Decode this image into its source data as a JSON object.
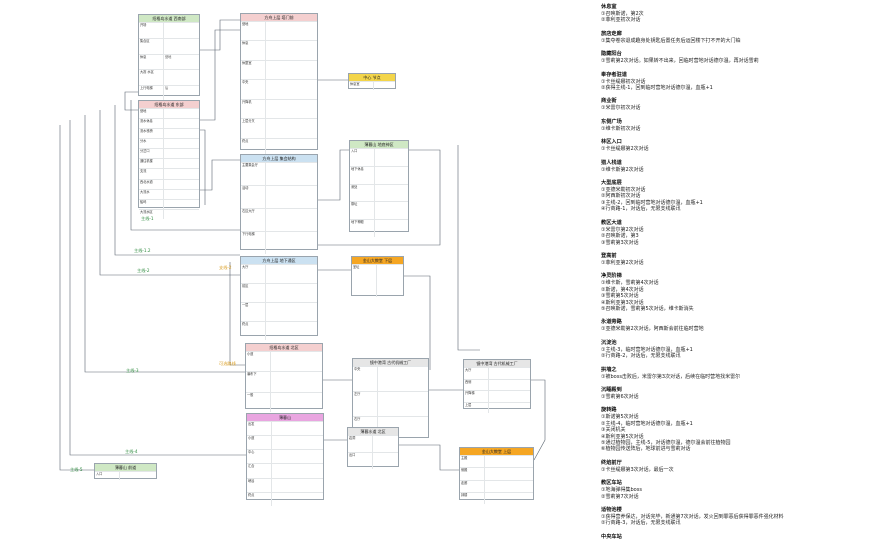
{
  "colors": {
    "line": "#5a6570",
    "green_header": "#cfe8c4",
    "pink_header": "#f4cfcf",
    "blue_header": "#cbe1f1",
    "gray_header": "#e6e6e6",
    "yellow_header": "#f3d54a",
    "orange_header": "#f5a623",
    "magenta_header": "#e9a5e0",
    "label_green": "#2d8a3e",
    "label_orange": "#d89a1a"
  },
  "diagram": {
    "nodes": [
      {
        "id": "n1",
        "title": "绍格岛水道 西南部",
        "header": "green",
        "rows": [
          [
            "开场",
            ""
          ],
          [
            "集合区",
            ""
          ],
          [
            "休息",
            "营地"
          ],
          [
            "大赛 水区",
            ""
          ],
          [
            "上行电梯",
            "后"
          ]
        ]
      },
      {
        "id": "n2",
        "title": "绍格岛水道 东部",
        "header": "pink",
        "rows": [
          [
            "营地",
            ""
          ],
          [
            "流水休息",
            ""
          ],
          [
            "流水栈桥",
            ""
          ],
          [
            "分水",
            ""
          ],
          [
            "分岔口",
            ""
          ],
          [
            "通往机楼",
            ""
          ],
          [
            "支流",
            ""
          ],
          [
            "西北水道",
            ""
          ],
          [
            "大流水",
            ""
          ],
          [
            "船坞",
            ""
          ],
          [
            "大流水区",
            ""
          ]
        ]
      },
      {
        "id": "n3",
        "title": "方舟上层 塔门前",
        "header": "pink",
        "rows": [
          [
            "营地",
            ""
          ],
          [
            "休息",
            ""
          ],
          [
            "休整室",
            ""
          ],
          [
            "中央",
            ""
          ],
          [
            "升降机",
            ""
          ],
          [
            "上层分叉",
            ""
          ],
          [
            "终点",
            ""
          ]
        ]
      },
      {
        "id": "n4",
        "title": "中心 节点",
        "header": "yellow",
        "rows": [
          [
            "休息室",
            ""
          ]
        ]
      },
      {
        "id": "n5",
        "title": "方舟上层 集会结构",
        "header": "blue",
        "rows": [
          [
            "主要集会厅",
            ""
          ],
          [
            "活动",
            ""
          ],
          [
            "右边大厅",
            ""
          ],
          [
            "下行电梯",
            ""
          ]
        ]
      },
      {
        "id": "n6",
        "title": "薄暮山 地底神区",
        "header": "green",
        "rows": [
          [
            "入口",
            ""
          ],
          [
            "地下休息",
            ""
          ],
          [
            "深处",
            ""
          ],
          [
            "祭坛",
            ""
          ],
          [
            "地下神殿",
            ""
          ]
        ]
      },
      {
        "id": "n7",
        "title": "方舟上层 地下通区",
        "header": "blue",
        "rows": [
          [
            "大厅",
            ""
          ],
          [
            "前区",
            ""
          ],
          [
            "一层",
            ""
          ],
          [
            "终点",
            ""
          ]
        ]
      },
      {
        "id": "n8",
        "title": "金山大教堂 下层",
        "header": "orange",
        "rows": [
          [
            "圣坛",
            ""
          ]
        ]
      },
      {
        "id": "n9",
        "title": "绍格岛水道 北区",
        "header": "pink",
        "rows": [
          [
            "小道",
            ""
          ],
          [
            "瀑布下",
            ""
          ],
          [
            "一般",
            ""
          ]
        ]
      },
      {
        "id": "n10",
        "title": "镜中港湾 古代机械工厂",
        "header": "gray",
        "rows": [
          [
            "中央",
            ""
          ],
          [
            "左厅",
            ""
          ],
          [
            "右厅",
            ""
          ]
        ]
      },
      {
        "id": "n11",
        "title": "镜中港湾 古代机械工厂",
        "header": "gray",
        "rows": [
          [
            "大厅",
            ""
          ],
          [
            "西侧",
            ""
          ],
          [
            "升降梯",
            ""
          ],
          [
            "上层",
            ""
          ]
        ]
      },
      {
        "id": "n12",
        "title": "薄暮山",
        "header": "magenta",
        "rows": [
          [
            "出发",
            ""
          ],
          [
            "小道",
            ""
          ],
          [
            "中心",
            ""
          ],
          [
            "汇合",
            ""
          ],
          [
            "峡谷",
            ""
          ],
          [
            "终点",
            ""
          ]
        ]
      },
      {
        "id": "n13",
        "title": "薄暮水道 北区",
        "header": "gray",
        "rows": [
          [
            "岩洞",
            ""
          ],
          [
            "出口",
            ""
          ]
        ]
      },
      {
        "id": "n14",
        "title": "金山大教堂 上层",
        "header": "orange",
        "rows": [
          [
            "主殿",
            ""
          ],
          [
            "侧殿",
            ""
          ],
          [
            "走廊",
            ""
          ],
          [
            "钟楼",
            ""
          ]
        ]
      },
      {
        "id": "n15",
        "title": "薄暮山 前道",
        "header": "green",
        "rows": [
          [
            "入口",
            ""
          ]
        ]
      }
    ],
    "edge_labels": [
      {
        "text": "主线-1",
        "color": "green"
      },
      {
        "text": "主线-1.2",
        "color": "green"
      },
      {
        "text": "主线-2",
        "color": "green"
      },
      {
        "text": "支线-2",
        "color": "orange"
      },
      {
        "text": "可选路线",
        "color": "orange"
      },
      {
        "text": "主线-3",
        "color": "green"
      },
      {
        "text": "主线-4",
        "color": "green"
      },
      {
        "text": "主线-5",
        "color": "green"
      }
    ]
  },
  "notes": [
    {
      "title": "休息室",
      "lines": [
        "①召唤斯诺，第2次",
        "②菲利亚初次对话"
      ]
    },
    {
      "title": "旅店走廊",
      "lines": [
        "①集夺卷宗退成趣身处钥匙后置任务后运回楼下打不开的大门铂"
      ]
    },
    {
      "title": "隐藏阳台",
      "lines": [
        "①雪莉第2次对话。如果转不出来，回临时营地对话德尔温，再对话雪莉"
      ]
    },
    {
      "title": "奉存者驻道",
      "lines": [
        "①卡丝缇娜初次对话",
        "②获得主线-1，回到临时营地对话德尔温，血瓶+1"
      ]
    },
    {
      "title": "商业街",
      "lines": [
        "①米雷尔初次对话"
      ]
    },
    {
      "title": "东侧广场",
      "lines": [
        "①维卡斯初次对话"
      ]
    },
    {
      "title": "林区入口",
      "lines": [
        "①卡丝缇娜第2次对话"
      ]
    },
    {
      "title": "猎人栈道",
      "lines": [
        "①维卡斯第2次对话"
      ]
    },
    {
      "title": "大型底层",
      "lines": [
        "①亚德米勒初次对话",
        "②阿西斯初次对话",
        "③主线-2，回到临时营地对话德尔温，血瓶+1",
        "④行商路-1，对话后，无限支线联讯"
      ]
    },
    {
      "title": "教区大道",
      "lines": [
        "①米雷尔第2次对话",
        "②召唤斯诺，第3",
        "③雪莉第3次对话"
      ]
    },
    {
      "title": "登高前",
      "lines": [
        "①菲利亚第2次对话"
      ]
    },
    {
      "title": "净灵阶梯",
      "lines": [
        "①维卡斯，雪莉第4次对话",
        "②斯诺，第4次对话",
        "③雪莉第5次对话",
        "④斯利亚第3次对话",
        "⑤召唤斯诺，雪莉第5次对话，维卡斯消失"
      ]
    },
    {
      "title": "永道旁路",
      "lines": [
        "①亚德米勒第2次对话，阿西斯会前往临时营地"
      ]
    },
    {
      "title": "沉淀池",
      "lines": [
        "①主线-3，临时营地对话德尔温，血瓶+1",
        "②行商路-2，对话后，无限支线联讯"
      ]
    },
    {
      "title": "拱墙之",
      "lines": [
        "①被boss击败后，米雷尔第3次对话，后续在临时营地找米雷尔"
      ]
    },
    {
      "title": "沉睡殿到",
      "lines": [
        "①雪莉第6次对话"
      ]
    },
    {
      "title": "旋转路",
      "lines": [
        "①斯诺第5次对话",
        "②主线-4，临时营地对话德尔温，血瓶+1",
        "③关闭机关",
        "④斯利亚第5次对话",
        "⑤通过植物园，主线-5，对话德尔温，德尔温会前往植物园",
        "⑥植物园传送阵后，地球前进与雪莉对话"
      ]
    },
    {
      "title": "终焰前厅",
      "lines": [
        "①卡丝缇娜第3次对话，最后一次"
      ]
    },
    {
      "title": "教区车站",
      "lines": [
        "①地海弹得集boss",
        "②雪莉第7次对话"
      ]
    },
    {
      "title": "适物池楼",
      "lines": [
        "①获得营养保达，对话完毕，新通第7次对话，发火回到罪恶后获得罪恶件强化材料",
        "②行商路-3，对话后，无限支线联讯"
      ]
    },
    {
      "title": "中央车站",
      "lines": []
    }
  ]
}
